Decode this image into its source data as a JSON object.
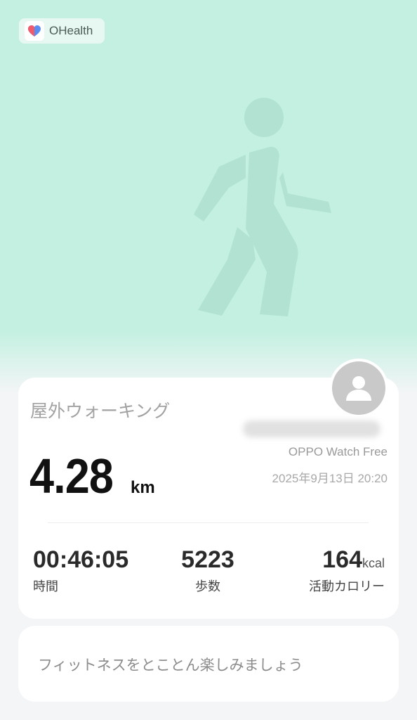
{
  "app": {
    "name": "OHealth"
  },
  "activity": {
    "title": "屋外ウォーキング",
    "device": "OPPO Watch Free",
    "datetime": "2025年9月13日 20:20",
    "distance": "4.28",
    "distance_unit": "km"
  },
  "stats": {
    "duration": {
      "value": "00:46:05",
      "label": "時間"
    },
    "steps": {
      "value": "5223",
      "label": "歩数"
    },
    "calories": {
      "value": "164",
      "unit": "kcal",
      "label": "活動カロリー"
    }
  },
  "motivation": {
    "text": "フィットネスをとことん楽しみましょう"
  },
  "icons": {
    "app_logo": "heart-icon",
    "hero": "walking-person-icon",
    "avatar": "user-icon"
  },
  "colors": {
    "hero_bg": "#c3f0e1",
    "walker": "#b2e2d2"
  }
}
